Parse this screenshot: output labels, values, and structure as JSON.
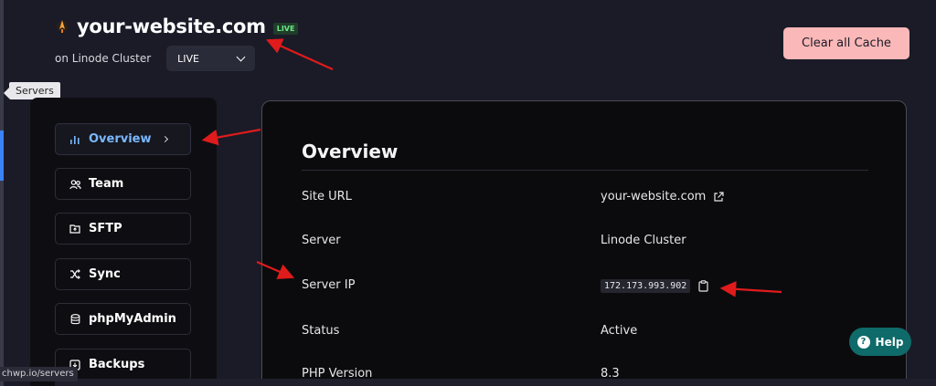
{
  "header": {
    "site_title": "your-website.com",
    "live_badge": "LIVE",
    "cluster_label": "on Linode Cluster",
    "environment_select": {
      "selected": "LIVE"
    },
    "clear_cache_label": "Clear all Cache"
  },
  "tooltip": {
    "text": "Servers"
  },
  "sidebar": {
    "items": [
      {
        "label": "Overview",
        "icon": "bar-chart-icon",
        "active": true
      },
      {
        "label": "Team",
        "icon": "users-icon"
      },
      {
        "label": "SFTP",
        "icon": "folder-upload-icon"
      },
      {
        "label": "Sync",
        "icon": "shuffle-icon"
      },
      {
        "label": "phpMyAdmin",
        "icon": "database-icon"
      },
      {
        "label": "Backups",
        "icon": "archive-icon"
      }
    ]
  },
  "overview": {
    "title": "Overview",
    "rows": [
      {
        "label": "Site URL",
        "value": "your-website.com",
        "icon": "external-link-icon"
      },
      {
        "label": "Server",
        "value": "Linode Cluster"
      },
      {
        "label": "Server IP",
        "value": "172.173.993.902",
        "icon": "clipboard-icon"
      },
      {
        "label": "Status",
        "value": "Active"
      },
      {
        "label": "PHP Version",
        "value": "8.3"
      }
    ]
  },
  "help": {
    "label": "Help"
  },
  "status_bar": {
    "url": "chwp.io/servers"
  },
  "colors": {
    "background": "#1a1b27",
    "panel": "#0b0b0e",
    "accent_blue": "#7ab8ff",
    "clear_cache_bg": "#fbb8b8",
    "help_bg": "#0f6a6a",
    "annotation_arrow": "#e01b1b"
  }
}
